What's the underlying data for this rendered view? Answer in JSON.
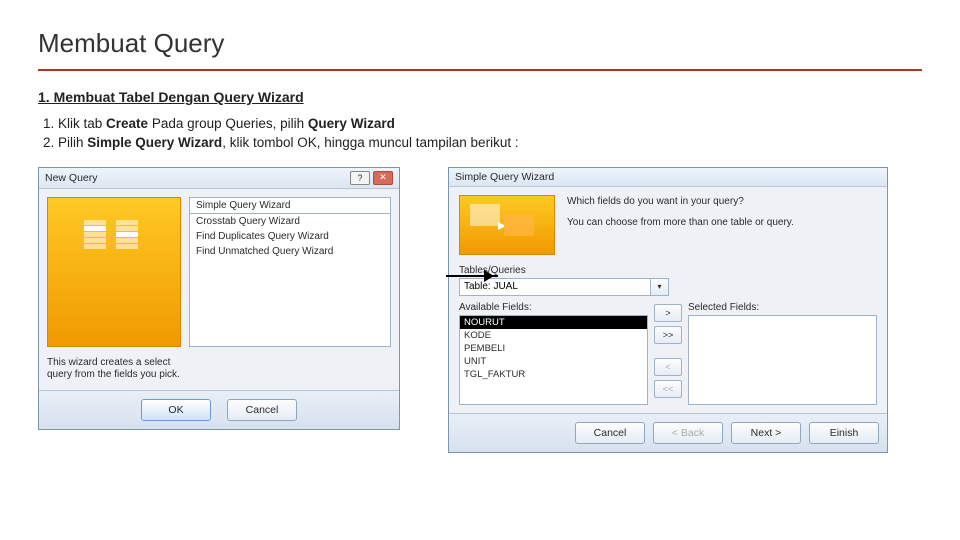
{
  "title": "Membuat Query",
  "subtitle": "1. Membuat Tabel Dengan Query Wizard",
  "steps": {
    "s1_a": "Klik tab ",
    "s1_b": "Create",
    "s1_c": " Pada group Queries, pilih ",
    "s1_d": "Query Wizard",
    "s2_a": "Pilih ",
    "s2_b": "Simple Query Wizard",
    "s2_c": ", klik tombol OK, hingga muncul tampilan berikut :"
  },
  "dlg1": {
    "title": "New Query",
    "help": "?",
    "close": "✕",
    "items": {
      "i0": "Simple Query Wizard",
      "i1": "Crosstab Query Wizard",
      "i2": "Find Duplicates Query Wizard",
      "i3": "Find Unmatched Query Wizard"
    },
    "desc": "This wizard creates a select query from the fields you pick.",
    "ok": "OK",
    "cancel": "Cancel"
  },
  "dlg2": {
    "title": "Simple Query Wizard",
    "prompt1": "Which fields do you want in your query?",
    "prompt2": "You can choose from more than one table or query.",
    "tqlabel": "Tables/Queries",
    "tqvalue": "Table: JUAL",
    "avail": "Available Fields:",
    "sel": "Selected Fields:",
    "fields": {
      "f0": "NOURUT",
      "f1": "KODE",
      "f2": "PEMBELI",
      "f3": "UNIT",
      "f4": "TGL_FAKTUR"
    },
    "move": {
      "add": ">",
      "addall": ">>",
      "rem": "<",
      "remall": "<<"
    },
    "cancel": "Cancel",
    "back": "< Back",
    "next": "Next >",
    "finish": "Einish"
  }
}
